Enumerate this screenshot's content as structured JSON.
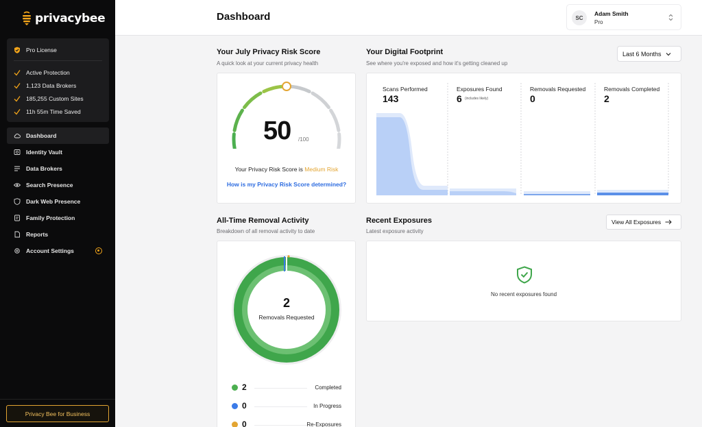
{
  "brand": {
    "name": "privacybee",
    "accent": "#f3a51a"
  },
  "license": {
    "title": "Pro License",
    "items": [
      "Active Protection",
      "1,123 Data Brokers",
      "185,255 Custom Sites",
      "11h 55m Time Saved"
    ]
  },
  "nav": {
    "items": [
      {
        "label": "Dashboard",
        "icon": "cloud-icon",
        "active": true
      },
      {
        "label": "Identity Vault",
        "icon": "vault-icon"
      },
      {
        "label": "Data Brokers",
        "icon": "list-icon"
      },
      {
        "label": "Search Presence",
        "icon": "eye-icon"
      },
      {
        "label": "Dark Web Presence",
        "icon": "shield-icon"
      },
      {
        "label": "Family Protection",
        "icon": "family-icon"
      },
      {
        "label": "Reports",
        "icon": "report-icon"
      },
      {
        "label": "Account Settings",
        "icon": "gear-icon"
      }
    ],
    "business_button": "Privacy Bee for Business"
  },
  "header": {
    "title": "Dashboard",
    "user": {
      "initials": "SC",
      "name": "Adam Smith",
      "plan": "Pro"
    }
  },
  "risk_score": {
    "title": "Your July Privacy Risk Score",
    "subtitle": "A quick look at your current privacy health",
    "score": "50",
    "max": "/100",
    "score_value": 50,
    "line_prefix": "Your Privacy Risk Score is",
    "level": "Medium Risk",
    "link": "How is my Privacy Risk Score determined?"
  },
  "footprint": {
    "title": "Your Digital Footprint",
    "subtitle": "See where you're exposed and how it's getting cleaned up",
    "range": "Last 6 Months",
    "columns": [
      {
        "label": "Scans Performed",
        "value": "143"
      },
      {
        "label": "Exposures Found",
        "value": "6",
        "note": "(includes likely)"
      },
      {
        "label": "Removals Requested",
        "value": "0"
      },
      {
        "label": "Removals Completed",
        "value": "2"
      }
    ]
  },
  "removal": {
    "title": "All-Time Removal Activity",
    "subtitle": "Breakdown of all removal activity to date",
    "center_value": "2",
    "center_label": "Removals Requested",
    "legend": [
      {
        "value": "2",
        "label": "Completed",
        "color": "#4caf50"
      },
      {
        "value": "0",
        "label": "In Progress",
        "color": "#3b7be8"
      },
      {
        "value": "0",
        "label": "Re-Exposures",
        "color": "#e3a532"
      }
    ]
  },
  "exposures": {
    "title": "Recent Exposures",
    "subtitle": "Latest exposure activity",
    "view_all": "View All Exposures",
    "empty": "No recent exposures found"
  }
}
